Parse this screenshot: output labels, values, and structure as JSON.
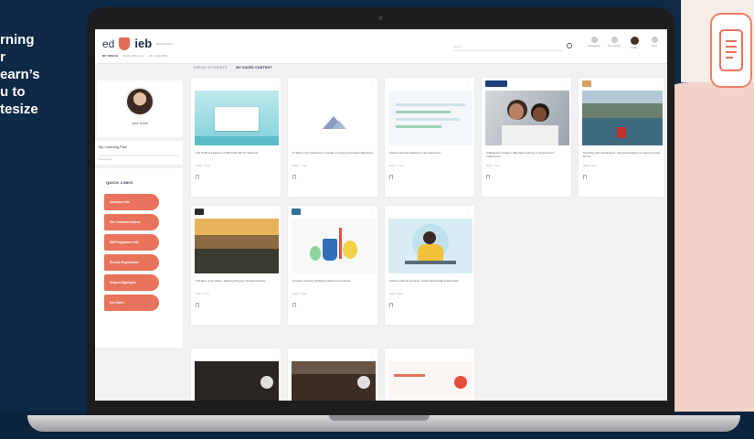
{
  "promo": {
    "lines": [
      "rning",
      "r",
      "earn’s",
      "u to",
      "tesize"
    ]
  },
  "app": {
    "logo_ed": "ed",
    "logo_ieb": "ieb",
    "logo_sub": "EDUCATION",
    "nav_tabs": [
      "MY SPACE",
      "EXPLORE ALL",
      "MY GROUPS"
    ],
    "search_placeholder": "Search",
    "top_icons": [
      {
        "name": "notifications-icon",
        "label": "Notifications"
      },
      {
        "name": "learning-icon",
        "label": "My Learning"
      },
      {
        "name": "profile-icon",
        "label": "Profile"
      },
      {
        "name": "menu-icon",
        "label": "Menu"
      }
    ]
  },
  "content": {
    "section_tabs": [
      "FOR MY STUDENTS",
      "MY SAVED CONTENT"
    ]
  },
  "sidebar": {
    "profile_name": "Jane Smith",
    "plan_title": "My Learning Plan",
    "plan_meta": "0% complete",
    "quick_title": "QUICK LINKS",
    "quick_links": [
      "Assessor Info",
      "Site Communications",
      "IEB Programme Info",
      "Results Registration",
      "Subject Highlights",
      "Key Dates"
    ]
  },
  "cards": [
    {
      "brand_color": "#f2f2f4",
      "title": "The 10 Best Features of Microsoft 365 for Teachers",
      "meta": "Article · 5 min",
      "thumb": "teal"
    },
    {
      "brand_color": "#f2f2f4",
      "title": "IT Skills in the Classroom: A Guide to Using Technology Effectively",
      "meta": "Article · 7 min",
      "thumb": "mountain"
    },
    {
      "brand_color": "#f2f2f4",
      "title": "Using Learning Analytics in the Classroom",
      "meta": "Article · 4 min",
      "thumb": "sheet"
    },
    {
      "brand_color": "#1f3d7a",
      "title": "A Beginner's Guide to Blended Learning in Schools and Classrooms",
      "meta": "Video · 3 min",
      "thumb": "people"
    },
    {
      "brand_color": "#d9a066",
      "title": "Teaching with Landscapes: Using Geography to Inspire Curious Minds",
      "meta": "Video · 4 min",
      "thumb": "lake"
    },
    {
      "brand_color": "#2b2b2b",
      "title": "The Rise of the Wave: Teaching Physics Through Oceans",
      "meta": "Video · 6 min",
      "thumb": "wave"
    },
    {
      "brand_color": "#2f6f9a",
      "title": "Creative Learning: Building Classroom Curiosity",
      "meta": "Article · 5 min",
      "thumb": "cup"
    },
    {
      "brand_color": "#f2f2f4",
      "title": "Online Learning at Home: Supporting Students Remotely",
      "meta": "Video · 8 min",
      "thumb": "desk"
    },
    {
      "brand_color": "#f2f2f4",
      "title": "",
      "meta": "",
      "thumb": "dark"
    },
    {
      "brand_color": "#f2f2f4",
      "title": "",
      "meta": "",
      "thumb": "library"
    },
    {
      "brand_color": "#f2f2f4",
      "title": "",
      "meta": "",
      "thumb": "blank"
    }
  ],
  "colors": {
    "navy": "#0e2946",
    "accent": "#e9735c",
    "screen_bg": "#f1f1f3"
  }
}
